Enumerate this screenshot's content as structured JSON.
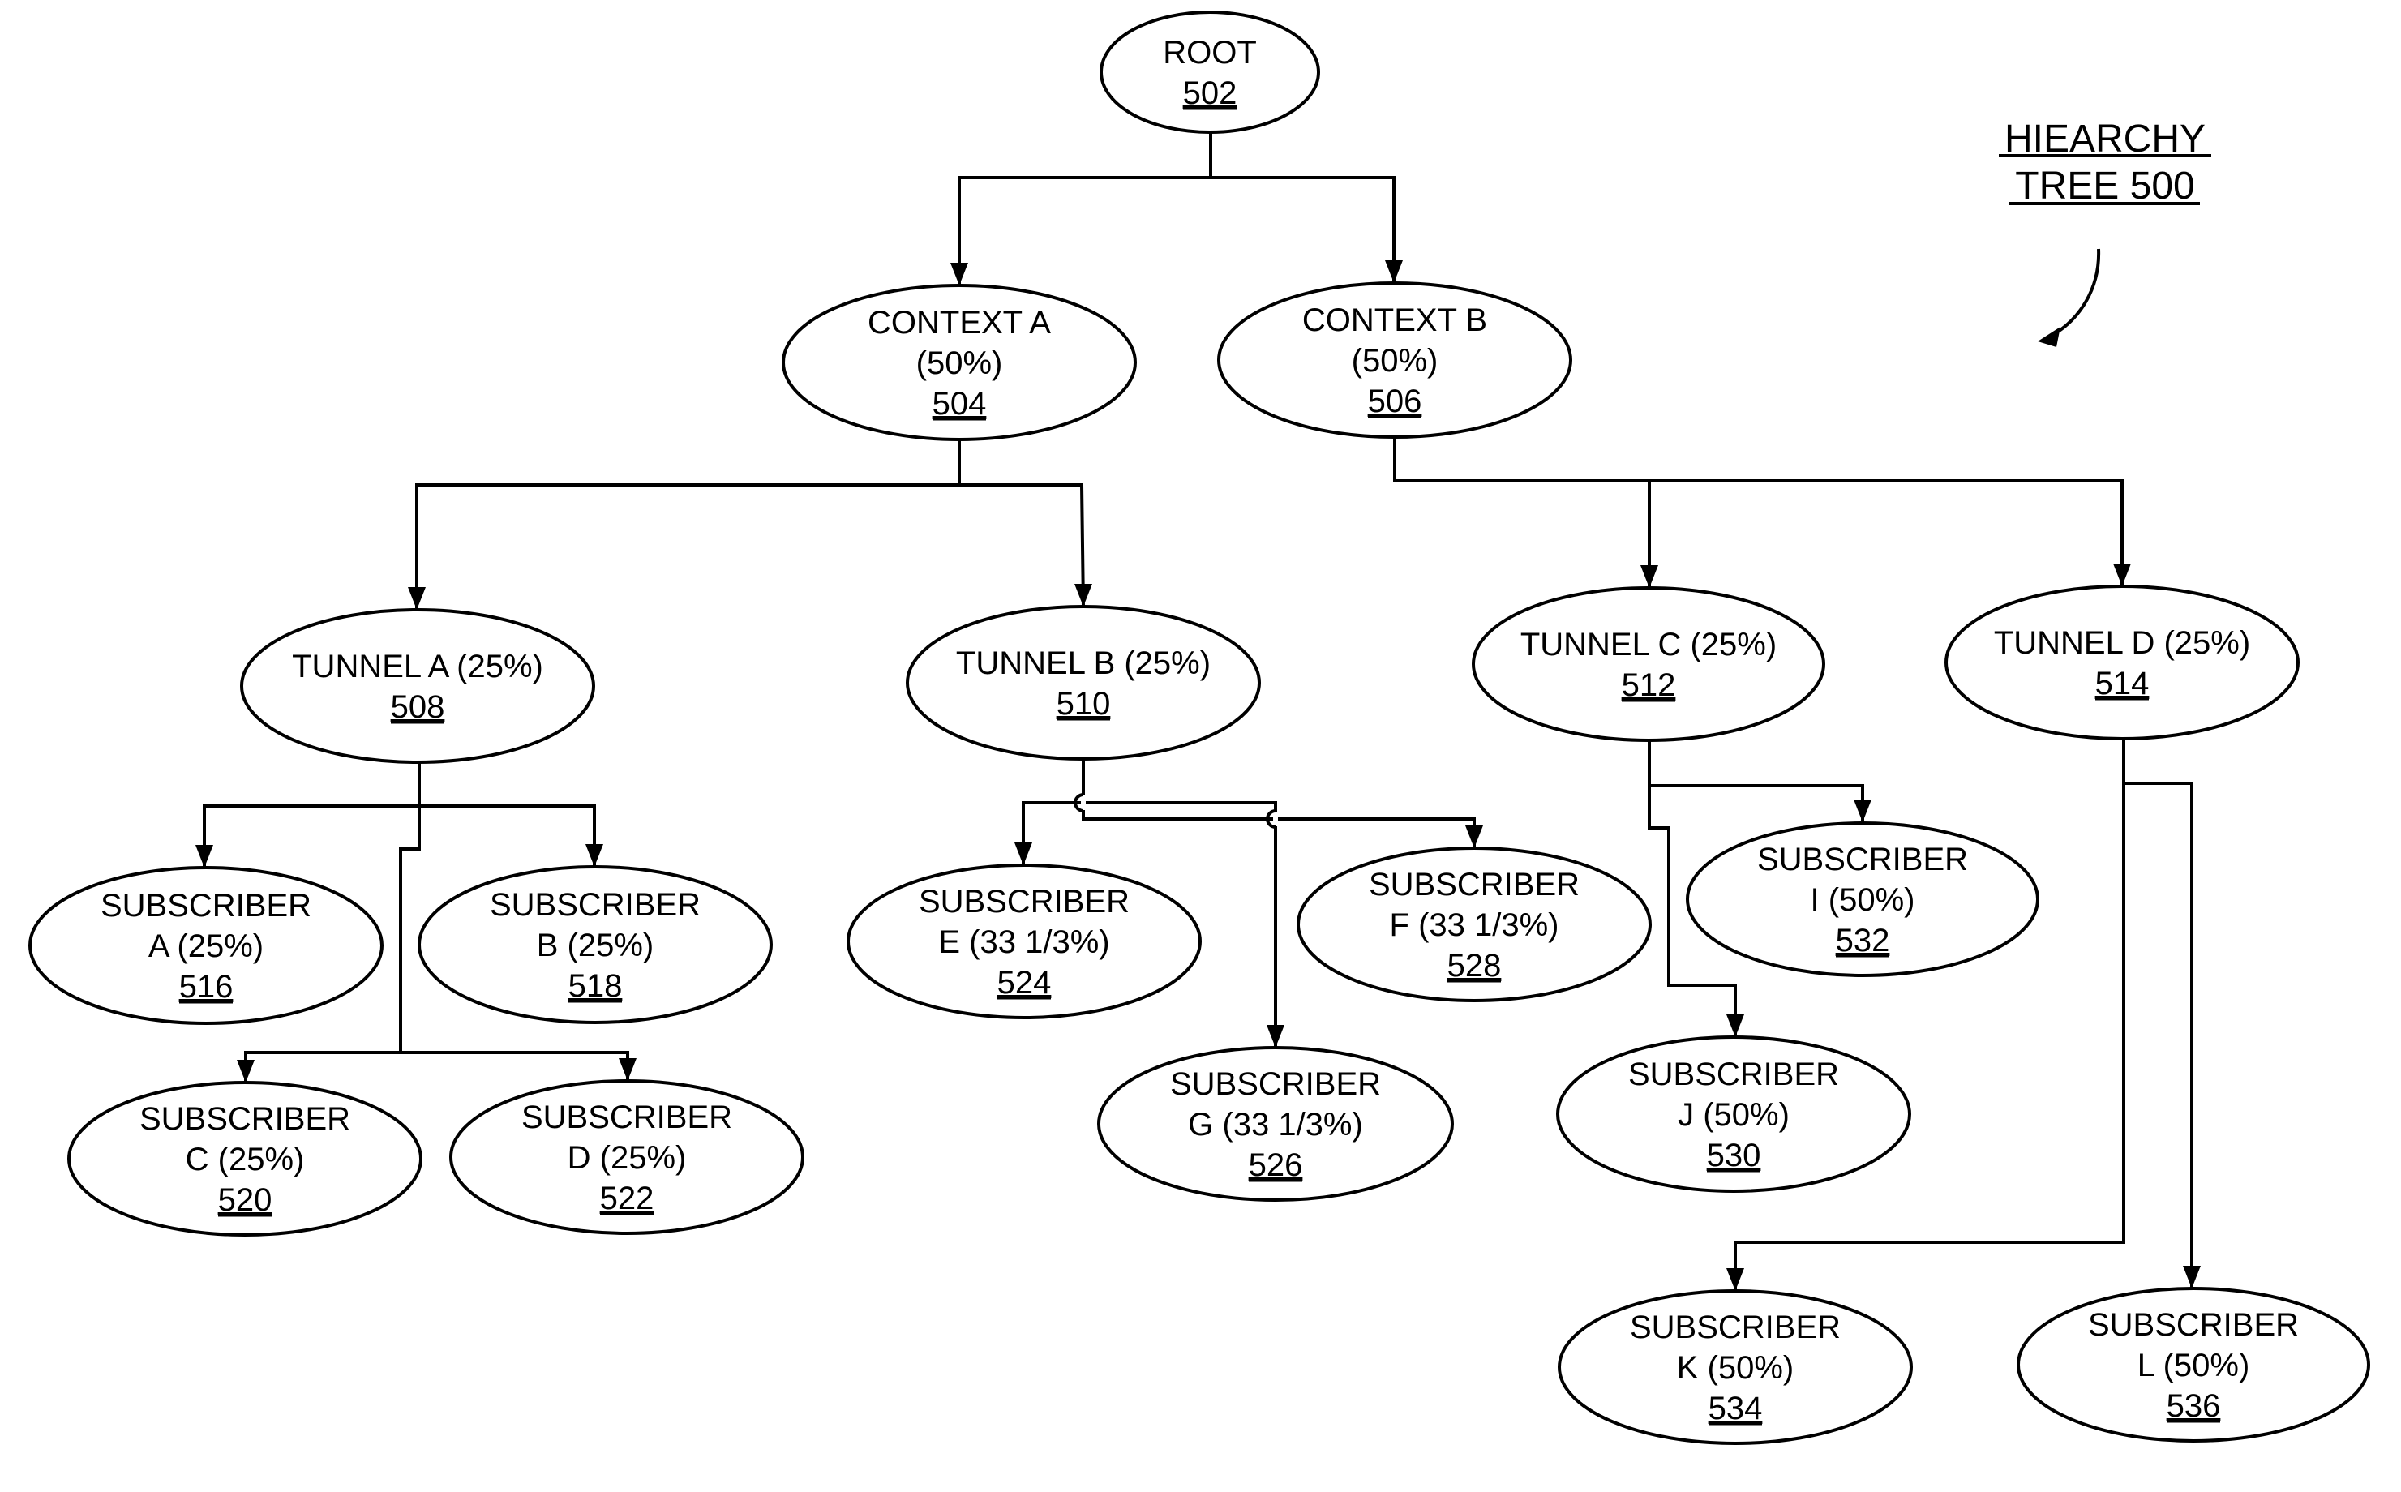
{
  "diagram": {
    "title": {
      "line1": "HIEARCHY",
      "line2": "TREE 500"
    },
    "nodes": {
      "root": {
        "lines": [
          "ROOT"
        ],
        "ref": "502"
      },
      "ctxA": {
        "lines": [
          "CONTEXT A",
          "(50%)"
        ],
        "ref": "504"
      },
      "ctxB": {
        "lines": [
          "CONTEXT B",
          "(50%)"
        ],
        "ref": "506"
      },
      "tunA": {
        "lines": [
          "TUNNEL A (25%)"
        ],
        "ref": "508"
      },
      "tunB": {
        "lines": [
          "TUNNEL B (25%)"
        ],
        "ref": "510"
      },
      "tunC": {
        "lines": [
          "TUNNEL C (25%)"
        ],
        "ref": "512"
      },
      "tunD": {
        "lines": [
          "TUNNEL D (25%)"
        ],
        "ref": "514"
      },
      "subA": {
        "lines": [
          "SUBSCRIBER",
          "A (25%)"
        ],
        "ref": "516"
      },
      "subB": {
        "lines": [
          "SUBSCRIBER",
          "B (25%)"
        ],
        "ref": "518"
      },
      "subC": {
        "lines": [
          "SUBSCRIBER",
          "C (25%)"
        ],
        "ref": "520"
      },
      "subD": {
        "lines": [
          "SUBSCRIBER",
          "D (25%)"
        ],
        "ref": "522"
      },
      "subE": {
        "lines": [
          "SUBSCRIBER",
          "E (33 1/3%)"
        ],
        "ref": "524"
      },
      "subG": {
        "lines": [
          "SUBSCRIBER",
          "G (33 1/3%)"
        ],
        "ref": "526"
      },
      "subF": {
        "lines": [
          "SUBSCRIBER",
          "F (33 1/3%)"
        ],
        "ref": "528"
      },
      "subJ": {
        "lines": [
          "SUBSCRIBER",
          "J (50%)"
        ],
        "ref": "530"
      },
      "subI": {
        "lines": [
          "SUBSCRIBER",
          "I (50%)"
        ],
        "ref": "532"
      },
      "subK": {
        "lines": [
          "SUBSCRIBER",
          "K (50%)"
        ],
        "ref": "534"
      },
      "subL": {
        "lines": [
          "SUBSCRIBER",
          "L (50%)"
        ],
        "ref": "536"
      }
    },
    "edges": [
      {
        "from": "root",
        "to": "ctxA"
      },
      {
        "from": "root",
        "to": "ctxB"
      },
      {
        "from": "ctxA",
        "to": "tunA"
      },
      {
        "from": "ctxA",
        "to": "tunB"
      },
      {
        "from": "ctxB",
        "to": "tunC"
      },
      {
        "from": "ctxB",
        "to": "tunD"
      },
      {
        "from": "tunA",
        "to": "subA"
      },
      {
        "from": "tunA",
        "to": "subB"
      },
      {
        "from": "tunA",
        "to": "subC"
      },
      {
        "from": "tunA",
        "to": "subD"
      },
      {
        "from": "tunB",
        "to": "subE"
      },
      {
        "from": "tunB",
        "to": "subF"
      },
      {
        "from": "tunB",
        "to": "subG"
      },
      {
        "from": "tunC",
        "to": "subI"
      },
      {
        "from": "tunC",
        "to": "subJ"
      },
      {
        "from": "tunD",
        "to": "subK"
      },
      {
        "from": "tunD",
        "to": "subL"
      }
    ]
  }
}
